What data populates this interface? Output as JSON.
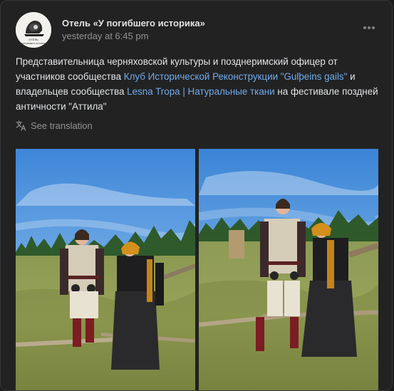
{
  "post": {
    "author": "Отель «У погибшего историка»",
    "time": "yesterday at 6:45 pm",
    "text_parts": [
      "Представительница черняховской культуры и позднеримский офицер от участников сообщества ",
      "Клуб Исторической Реконструкции \"Gulþeins gails\"",
      " и владельцев сообщества ",
      "Lesna Tropa | Натуральные ткани",
      " на фестивале поздней античности \"Аттила\""
    ],
    "links": [
      "Клуб Исторической Реконструкции \"Gulþeins gails\"",
      "Lesna Tropa | Натуральные ткани"
    ],
    "translate_label": "See translation",
    "avatar_text": [
      "ОТЕЛЬ",
      "«У ПОГИБШЕГО ИСТОРИКА»"
    ]
  },
  "icons": [
    "more-horizontal-icon",
    "translate-icon"
  ],
  "photos": [
    {
      "alt": "photo-1"
    },
    {
      "alt": "photo-2"
    }
  ],
  "colors": {
    "background": "#222222",
    "text": "#e1e3e6",
    "secondary": "#939393",
    "link": "#71aaeb"
  }
}
